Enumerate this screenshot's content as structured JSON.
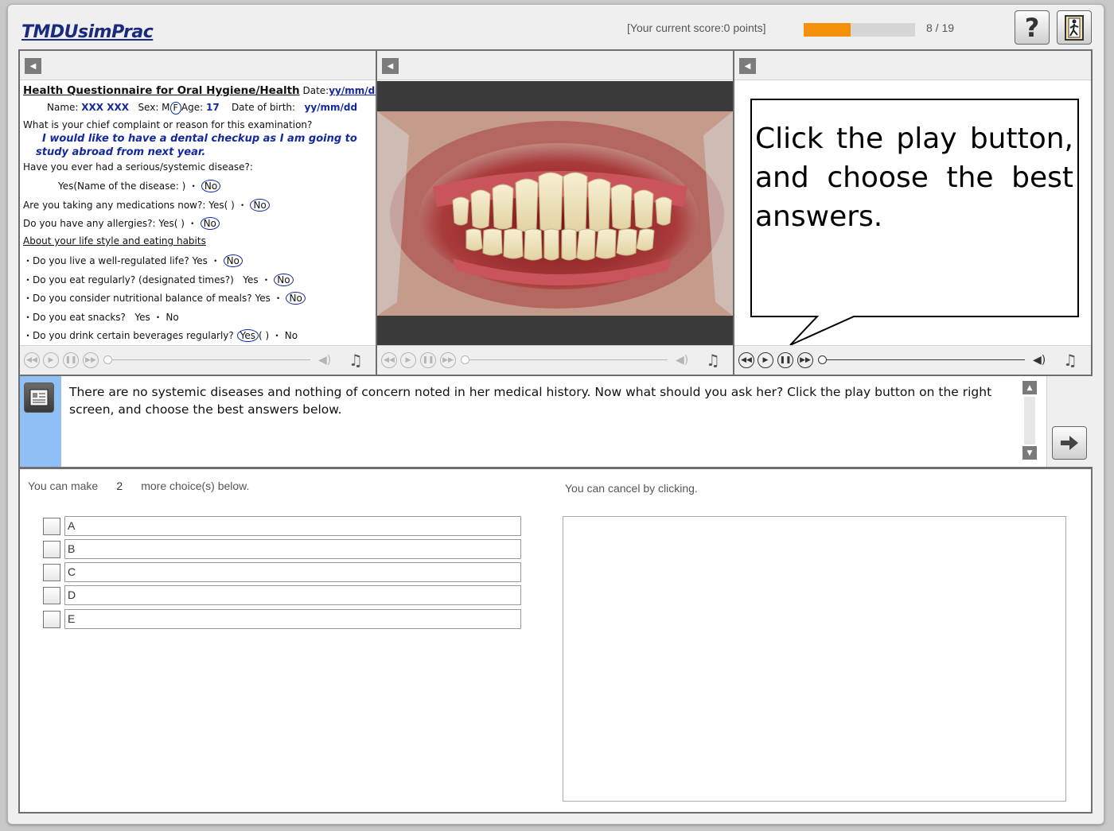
{
  "header": {
    "logo": "TMDUsimPrac",
    "score_text": "[Your current score:0 points]",
    "progress": {
      "current": 8,
      "total": 19,
      "fraction": 0.42
    },
    "counter": "8 / 19",
    "help_label": "?",
    "colors": {
      "progress_fill": "#f5900a",
      "logo": "#1a2a7c"
    }
  },
  "questionnaire": {
    "title": "Health Questionnaire for Oral Hygiene/Health",
    "date_label": "Date:",
    "date_value": "yy/mm/dd",
    "name_label": "Name:",
    "name_value": "XXX  XXX",
    "sex_label": "Sex: M",
    "sex_value": "F",
    "age_label": "Age:",
    "age_value": "17",
    "dob_label": "Date of birth:",
    "dob_value": "yy/mm/dd",
    "q_complaint": "What is your chief complaint or reason for this examination?",
    "a_complaint_1": "I would like to have a dental checkup as I am going to",
    "a_complaint_2": "study abroad from next year.",
    "q_disease": "Have you ever had a serious/systemic disease?:",
    "q_disease_opts": "Yes(Name of the disease:                                    )  ・",
    "q_meds": "Are you taking any medications now?:",
    "q_meds_opts": "Yes(                                      )  ・",
    "q_allergy": "Do you have any allergies?:",
    "q_allergy_opts": "Yes(                       )  ・",
    "lifestyle_heading": "About your life style and eating habits",
    "q_life": "・Do you live a well-regulated life?",
    "q_life_opts": " Yes  ・",
    "q_eat": "・Do you eat regularly? (designated times?)",
    "q_eat_opts": " Yes  ・",
    "q_nutrition": "・Do you consider nutritional balance of meals?",
    "q_nutrition_opts": " Yes  ・",
    "q_snack": "・Do you eat snacks?",
    "q_snack_opts": " Yes  ・  No",
    "q_bev": "・Do you drink certain beverages regularly?",
    "q_bev_yes": "Yes",
    "q_bev_opts": "(                         )  ・  No",
    "no": "No"
  },
  "speech": {
    "text": "Click the play button, and choose the best answers."
  },
  "message": {
    "text": "There are no systemic diseases and nothing of concern noted in her medical history. Now what should you ask her? Click the play button on the right screen, and choose the best answers below."
  },
  "answers": {
    "remaining_prefix": "You can make",
    "remaining_count": "2",
    "remaining_suffix": "more choice(s) below.",
    "cancel_hint": "You can cancel by clicking.",
    "options": [
      "A",
      "B",
      "C",
      "D",
      "E"
    ]
  },
  "icons": {
    "back": "back-arrow-icon",
    "rewind": "rewind-icon",
    "play": "play-icon",
    "pause": "pause-icon",
    "forward": "fast-forward-icon",
    "volume": "volume-icon",
    "music": "music-note-icon",
    "notes": "notes-icon",
    "next": "next-arrow-icon",
    "exit": "exit-door-icon"
  }
}
